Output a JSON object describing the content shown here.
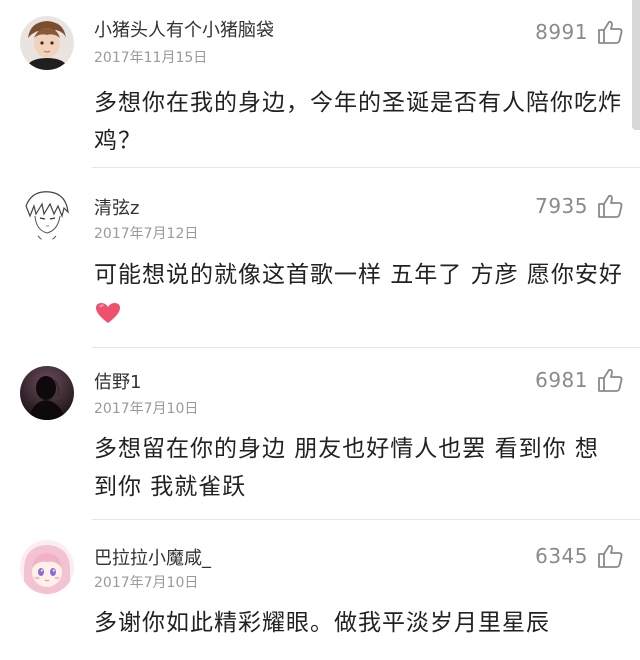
{
  "comments": [
    {
      "username": "小猪头人有个小猪脑袋",
      "date": "2017年11月15日",
      "likes": "8991",
      "text_lines": [
        "多想你在我的身边，今年的圣诞是否有人陪你吃炸",
        "鸡？"
      ],
      "avatar": "user-photo-avatar",
      "has_emoji": false
    },
    {
      "username": "清弦z",
      "date": "2017年7月12日",
      "likes": "7935",
      "text_lines": [
        "可能想说的就像这首歌一样  五年了  方彦 愿你安好"
      ],
      "avatar": "anime-sketch-avatar",
      "has_emoji": true,
      "emoji": "heart-icon"
    },
    {
      "username": "佶野1",
      "date": "2017年7月10日",
      "likes": "6981",
      "text_lines": [
        "多想留在你的身边  朋友也好情人也罢    看到你 想",
        "到你 我就雀跃"
      ],
      "avatar": "dark-silhouette-avatar",
      "has_emoji": false
    },
    {
      "username": "巴拉拉小魔咸_",
      "date": "2017年7月10日",
      "likes": "6345",
      "text_lines": [
        "多谢你如此精彩耀眼。做我平淡岁月里星辰"
      ],
      "avatar": "anime-girl-avatar",
      "has_emoji": false
    }
  ],
  "colors": {
    "text": "#222222",
    "username": "#333333",
    "meta": "#9a9a9a",
    "like": "#8a8a8a",
    "heart": "#f0506e"
  },
  "icons": {
    "like": "thumbs-up-icon"
  }
}
